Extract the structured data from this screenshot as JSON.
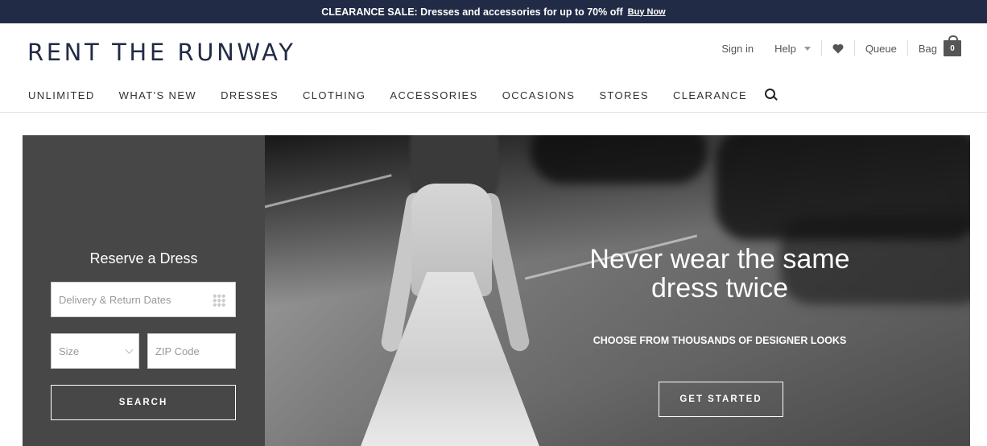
{
  "promo": {
    "text": "CLEARANCE SALE: Dresses and accessories for up to 70% off",
    "cta": "Buy Now",
    "bg_color": "#222b45"
  },
  "header": {
    "logo": "RENT THE RUNWAY",
    "sign_in": "Sign in",
    "help": "Help",
    "queue": "Queue",
    "bag": "Bag",
    "bag_count": "0",
    "icons": [
      "heart-icon",
      "caret-down-icon",
      "bag-icon"
    ]
  },
  "nav": {
    "items": [
      "UNLIMITED",
      "WHAT'S NEW",
      "DRESSES",
      "CLOTHING",
      "ACCESSORIES",
      "OCCASIONS",
      "STORES",
      "CLEARANCE"
    ],
    "search_icon": "search-icon"
  },
  "reserve": {
    "title": "Reserve a Dress",
    "dates_placeholder": "Delivery & Return Dates",
    "size_placeholder": "Size",
    "zip_placeholder": "ZIP Code",
    "search_label": "SEARCH",
    "panel_color": "#474747"
  },
  "hero": {
    "headline": "Never wear the same dress twice",
    "subhead": "CHOOSE FROM THOUSANDS OF DESIGNER LOOKS",
    "cta": "GET STARTED"
  }
}
